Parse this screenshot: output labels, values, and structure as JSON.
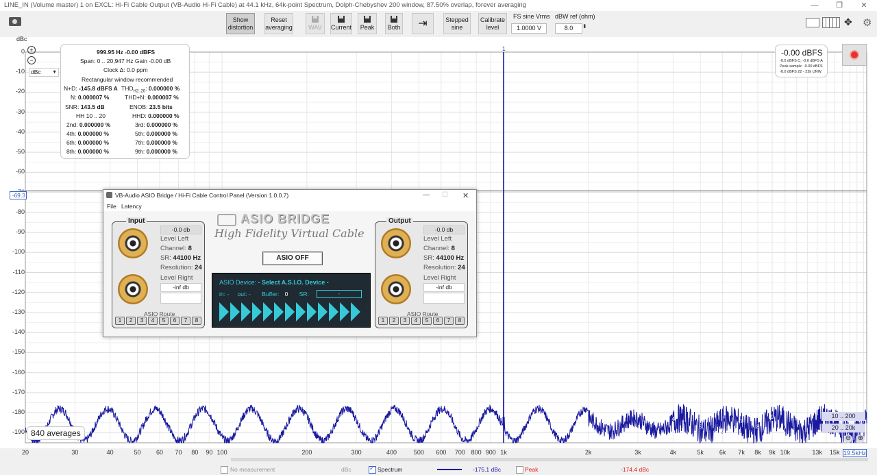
{
  "window": {
    "title": "LINE_IN (Volume master) 1 on EXCL: Hi-Fi Cable Output (VB-Audio Hi-Fi Cable) at 44.1 kHz, 64k-point Spectrum, Dolph-Chebyshev 200 window, 87.50% overlap, forever averaging"
  },
  "toolbar": {
    "show_distortion": "Show distortion",
    "reset_averaging": "Reset averaging",
    "wav": "WAV",
    "current": "Current",
    "peak": "Peak",
    "both": "Both",
    "stepped_sine": "Stepped sine",
    "calibrate_level": "Calibrate level",
    "fs_sine_label": "FS sine Vrms",
    "fs_sine_value": "1.0000 V",
    "dbw_ref_label": "dBW ref (ohm)",
    "dbw_ref_value": "8.0"
  },
  "plot": {
    "y_unit": "dBc",
    "y_unit_select": "dBc",
    "cursor_value": "-69.3",
    "y_ticks": [
      "0",
      "-10",
      "-20",
      "-30",
      "-40",
      "-50",
      "-60",
      "-70",
      "-80",
      "-90",
      "-100",
      "-110",
      "-120",
      "-130",
      "-140",
      "-150",
      "-160",
      "-170",
      "-180",
      "-190"
    ],
    "x_ticks": [
      "20",
      "30",
      "40",
      "50",
      "60",
      "70",
      "80",
      "90",
      "100",
      "200",
      "300",
      "400",
      "500",
      "600",
      "700",
      "800",
      "900",
      "1k",
      "2k",
      "3k",
      "4k",
      "5k",
      "6k",
      "7k",
      "8k",
      "9k",
      "10k",
      "13k",
      "15k",
      "17k",
      "19.5kHz"
    ],
    "peak_marker": "1",
    "harmonic_markers": [
      "2",
      "3",
      "4",
      "5",
      "6",
      "7",
      "8",
      "9"
    ],
    "averages": "840 averages",
    "range_btn_1": "10 .. 200",
    "range_btn_2": "20 .. 20k"
  },
  "stats": {
    "freq_line": "999.95 Hz  -0.00 dBFS",
    "span_line": "Span: 0 .. 20,947 Hz  Gain -0.00 dB",
    "clock_line": "Clock Δ: 0.0 ppm",
    "window_line": "Rectangular window recommended",
    "nd_label": "N+D:",
    "nd_value": "-145.8 dBFS A",
    "thd_label": "THD",
    "thd_sub": "H2..20",
    "thd_value": "0.000000 %",
    "n_label": "N:",
    "n_value": "0.000007 %",
    "thdn_label": "THD+N:",
    "thdn_value": "0.000007 %",
    "snr_label": "SNR:",
    "snr_value": "143.5 dB",
    "enob_label": "ENOB:",
    "enob_value": "23.5 bits",
    "hh_label": "HH 10 .. 20",
    "hhd_label": "HHD:",
    "hhd_value": "0.000000 %",
    "h2_label": "2nd:",
    "h2_value": "0.000000 %",
    "h3_label": "3rd:",
    "h3_value": "0.000000 %",
    "h4_label": "4th:",
    "h4_value": "0.000000 %",
    "h5_label": "5th:",
    "h5_value": "0.000000 %",
    "h6_label": "6th:",
    "h6_value": "0.000000 %",
    "h7_label": "7th:",
    "h7_value": "0.000000 %",
    "h8_label": "8th:",
    "h8_value": "0.000000 %",
    "h9_label": "9th:",
    "h9_value": "0.000000 %"
  },
  "level_box": {
    "main": "-0.00 dBFS",
    "l1": "-0.0 dBFS C, -0.0 dBFS A",
    "l2": "Peak sample: -0.00 dBFS",
    "l3": "-0.0 dBFS 22 - 22k UNW"
  },
  "dialog": {
    "title": "VB-Audio ASIO Bridge / Hi-Fi Cable Control Panel (Version 1.0.0.7)",
    "menu_file": "File",
    "menu_latency": "Latency",
    "logo_main": "ASIO BRIDGE",
    "logo_sub": "High Fidelity Virtual Cable",
    "input_title": "Input",
    "output_title": "Output",
    "in_level_db": "-0.0 db",
    "in_level_left": "Level Left",
    "in_channel_label": "Channel:",
    "in_channel": "8",
    "in_sr_label": "SR:",
    "in_sr": "44100 Hz",
    "in_res_label": "Resolution:",
    "in_res": "24",
    "in_level_right": "Level Right",
    "in_right_db": "-inf db",
    "out_level_db": "-0.0 db",
    "out_level_left": "Level Left",
    "out_channel_label": "Channel:",
    "out_channel": "8",
    "out_sr_label": "SR:",
    "out_sr": "44100 Hz",
    "out_res_label": "Resolution:",
    "out_res": "24",
    "out_level_right": "Level Right",
    "out_right_db": "-inf db",
    "asio_route": "ASIO Route",
    "routes": [
      "1",
      "2",
      "3",
      "4",
      "5",
      "6",
      "7",
      "8"
    ],
    "asio_off": "ASIO OFF",
    "device_label": "ASIO Device:",
    "device_value": "- Select A.S.I.O. Device -",
    "in_lbl": "in: -",
    "out_lbl": "out: -",
    "buffer_lbl": "Buffer:",
    "buffer_val": "0",
    "sr_lbl": "SR:",
    "sr_val": "-"
  },
  "footer": {
    "no_measurement": "No measurement",
    "unit1": "dBc",
    "spectrum": "Spectrum",
    "spectrum_val": "-175.1 dBc",
    "peak": "Peak",
    "peak_val": "-174.4 dBc"
  },
  "colors": {
    "trace": "#1a1aa0",
    "accent_red": "#e0201a",
    "range_btn": "#d9d9f2"
  }
}
